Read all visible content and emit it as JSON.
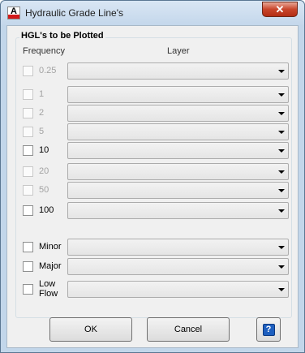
{
  "window": {
    "title": "Hydraulic Grade Line's",
    "app_icon_letter": "A",
    "close_label": "✕"
  },
  "group": {
    "title": "HGL's to be Plotted",
    "col_frequency": "Frequency",
    "col_layer": "Layer"
  },
  "rows": [
    {
      "label": "0.25",
      "enabled": false,
      "checked": false,
      "layer": ""
    },
    {
      "label": "1",
      "enabled": false,
      "checked": false,
      "layer": ""
    },
    {
      "label": "2",
      "enabled": false,
      "checked": false,
      "layer": ""
    },
    {
      "label": "5",
      "enabled": false,
      "checked": false,
      "layer": ""
    },
    {
      "label": "10",
      "enabled": true,
      "checked": false,
      "layer": ""
    },
    {
      "label": "20",
      "enabled": false,
      "checked": false,
      "layer": ""
    },
    {
      "label": "50",
      "enabled": false,
      "checked": false,
      "layer": ""
    },
    {
      "label": "100",
      "enabled": true,
      "checked": false,
      "layer": ""
    },
    {
      "label": "Minor",
      "enabled": true,
      "checked": false,
      "layer": ""
    },
    {
      "label": "Major",
      "enabled": true,
      "checked": false,
      "layer": ""
    },
    {
      "label": "Low Flow",
      "enabled": true,
      "checked": false,
      "layer": ""
    }
  ],
  "buttons": {
    "ok": "OK",
    "cancel": "Cancel",
    "help_glyph": "?"
  },
  "icons": {
    "app": "autocad-app-icon",
    "close": "close-icon",
    "help": "help-icon",
    "dropdown": "chevron-down-icon"
  }
}
